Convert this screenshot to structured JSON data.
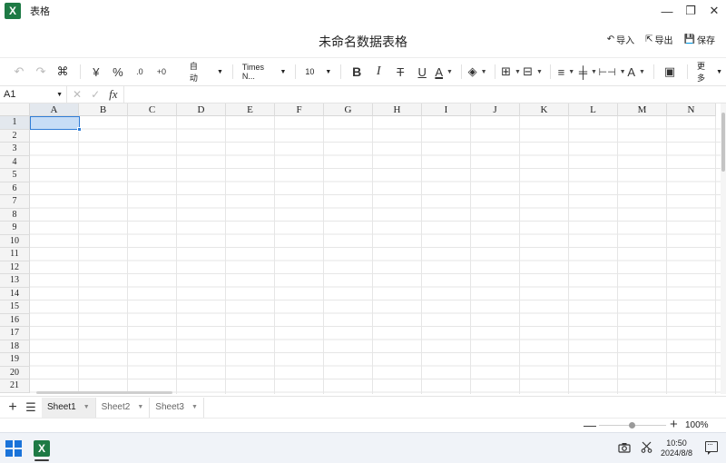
{
  "window": {
    "app_icon": "X",
    "title": "表格",
    "controls": {
      "minimize": "—",
      "restore": "❐",
      "close": "✕"
    }
  },
  "doc": {
    "title": "未命名数据表格",
    "actions": [
      {
        "icon": "↶",
        "label": "导入"
      },
      {
        "icon": "⇱",
        "label": "导出"
      },
      {
        "icon": "💾",
        "label": "保存"
      }
    ]
  },
  "toolbar": {
    "undo": "↶",
    "redo": "↷",
    "format_painter": "⌘",
    "currency": "¥",
    "percent": "%",
    "decimal_decrease": ".0",
    "decimal_increase": "+0",
    "number_format": "自动",
    "font_family": "Times N...",
    "font_size": "10",
    "bold": "B",
    "italic": "I",
    "strikethrough": "T",
    "underline": "U",
    "font_color": "A",
    "fill_color": "◈",
    "borders": "⊞",
    "merge": "⊟",
    "align_horizontal": "≡",
    "align_vertical": "╪",
    "text_wrap": "⊢⊣",
    "text_rotate": "A",
    "image": "▣",
    "more": "更多",
    "accent_color": "#2f7cd6"
  },
  "formula": {
    "cell_ref": "A1",
    "cancel": "✕",
    "confirm": "✓",
    "fx": "fx",
    "value": ""
  },
  "grid": {
    "columns": [
      "A",
      "B",
      "C",
      "D",
      "E",
      "F",
      "G",
      "H",
      "I",
      "J",
      "K",
      "L",
      "M",
      "N"
    ],
    "rows": [
      "1",
      "2",
      "3",
      "4",
      "5",
      "6",
      "7",
      "8",
      "9",
      "10",
      "11",
      "12",
      "13",
      "14",
      "15",
      "16",
      "17",
      "18",
      "19",
      "20",
      "21"
    ],
    "selected_cell": "A1"
  },
  "sheets": {
    "add": "+",
    "list": "☰",
    "tabs": [
      "Sheet1",
      "Sheet2",
      "Sheet3"
    ],
    "active": "Sheet1"
  },
  "zoom": {
    "minus": "—",
    "plus": "+",
    "level": "100%",
    "value": 1.0
  },
  "taskbar": {
    "excel_icon": "X",
    "time": "10:50",
    "date": "2024/8/8"
  }
}
